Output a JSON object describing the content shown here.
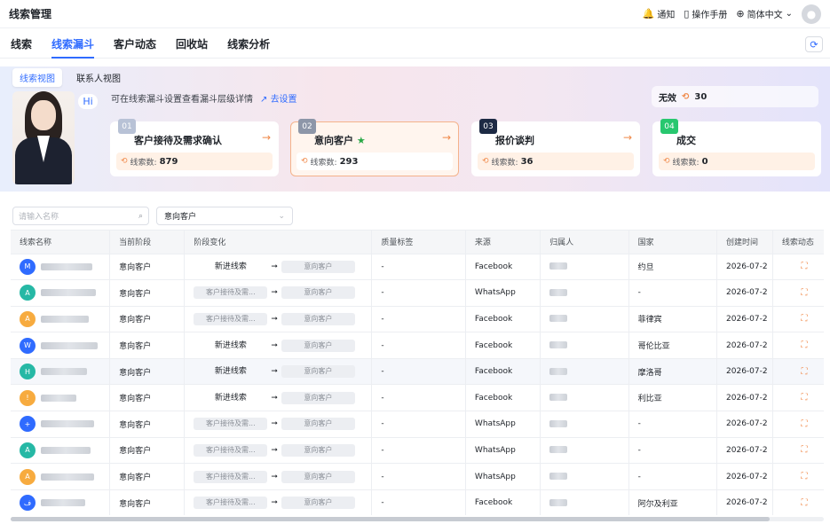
{
  "app_title": "线索管理",
  "topbar": {
    "notify": "通知",
    "manual": "操作手册",
    "language": "简体中文"
  },
  "tabs": [
    "线索",
    "线索漏斗",
    "客户动态",
    "回收站",
    "线索分析"
  ],
  "view_tabs": [
    "线索视图",
    "联系人视图"
  ],
  "hero": {
    "hi": "Hi",
    "hint": "可在线索漏斗设置查看漏斗层级详情",
    "hint_link": "去设置",
    "invalid_label": "无效",
    "invalid_count": "30",
    "count_label": "线索数:",
    "stages": [
      {
        "num": "01",
        "name": "客户接待及需求确认",
        "count": "879",
        "color": "#b8c2d6"
      },
      {
        "num": "02",
        "name": "意向客户",
        "count": "293",
        "color": "#8d96a8"
      },
      {
        "num": "03",
        "name": "报价谈判",
        "count": "36",
        "color": "#1d2a44"
      },
      {
        "num": "04",
        "name": "成交",
        "count": "0",
        "color": "#28c76f"
      }
    ]
  },
  "filters": {
    "search_placeholder": "请输入名称",
    "stage_value": "意向客户"
  },
  "table": {
    "headers": [
      "线索名称",
      "当前阶段",
      "阶段变化",
      "质量标签",
      "来源",
      "归属人",
      "国家",
      "创建时间",
      "线索动态"
    ],
    "rows": [
      {
        "initial": "M",
        "color": "#2f6bff",
        "stage": "意向客户",
        "from": "新进线索",
        "to": "意向客户",
        "quality": "-",
        "source": "Facebook",
        "country": "约旦",
        "created": "2026-07-2"
      },
      {
        "initial": "A",
        "color": "#26b8a5",
        "stage": "意向客户",
        "from": "客户接待及需...",
        "to": "意向客户",
        "quality": "-",
        "source": "WhatsApp",
        "country": "-",
        "created": "2026-07-2"
      },
      {
        "initial": "A",
        "color": "#f7ab3f",
        "stage": "意向客户",
        "from": "客户接待及需...",
        "to": "意向客户",
        "quality": "-",
        "source": "Facebook",
        "country": "菲律宾",
        "created": "2026-07-2"
      },
      {
        "initial": "W",
        "color": "#2f6bff",
        "stage": "意向客户",
        "from": "新进线索",
        "to": "意向客户",
        "quality": "-",
        "source": "Facebook",
        "country": "哥伦比亚",
        "created": "2026-07-2"
      },
      {
        "initial": "H",
        "color": "#26b8a5",
        "stage": "意向客户",
        "from": "新进线索",
        "to": "意向客户",
        "quality": "-",
        "source": "Facebook",
        "country": "摩洛哥",
        "created": "2026-07-2"
      },
      {
        "initial": "!",
        "color": "#f7ab3f",
        "stage": "意向客户",
        "from": "新进线索",
        "to": "意向客户",
        "quality": "-",
        "source": "Facebook",
        "country": "利比亚",
        "created": "2026-07-2"
      },
      {
        "initial": "+",
        "color": "#2f6bff",
        "stage": "意向客户",
        "from": "客户接待及需...",
        "to": "意向客户",
        "quality": "-",
        "source": "WhatsApp",
        "country": "-",
        "created": "2026-07-2"
      },
      {
        "initial": "A",
        "color": "#26b8a5",
        "stage": "意向客户",
        "from": "客户接待及需...",
        "to": "意向客户",
        "quality": "-",
        "source": "WhatsApp",
        "country": "-",
        "created": "2026-07-2"
      },
      {
        "initial": "A",
        "color": "#f7ab3f",
        "stage": "意向客户",
        "from": "客户接待及需...",
        "to": "意向客户",
        "quality": "-",
        "source": "WhatsApp",
        "country": "-",
        "created": "2026-07-2"
      },
      {
        "initial": "ف",
        "color": "#2f6bff",
        "stage": "意向客户",
        "from": "客户接待及需...",
        "to": "意向客户",
        "quality": "-",
        "source": "Facebook",
        "country": "阿尔及利亚",
        "created": "2026-07-2"
      }
    ]
  }
}
